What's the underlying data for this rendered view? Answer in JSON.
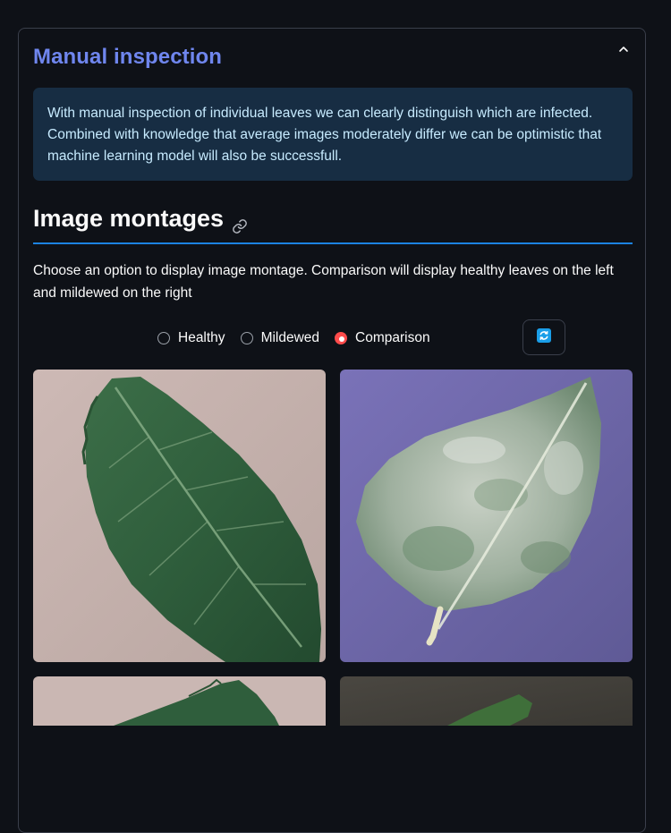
{
  "expander": {
    "title": "Manual inspection",
    "collapse_icon": "chevron-up-icon"
  },
  "info": {
    "text": "With manual inspection of individual leaves we can clearly distinguish which are infected. Combined with knowledge that average images moderately differ we can be optimistic that machine learning model will also be successfull."
  },
  "section": {
    "title": "Image montages",
    "anchor_icon": "link-icon"
  },
  "description": "Choose an option to display image montage. Comparison will display healthy leaves on the left and mildewed on the right",
  "radio": {
    "options": [
      "Healthy",
      "Mildewed",
      "Comparison"
    ],
    "selected": "Comparison"
  },
  "refresh_button": {
    "icon": "refresh-icon"
  },
  "images": [
    {
      "name": "healthy-leaf-image",
      "type": "healthy"
    },
    {
      "name": "mildewed-leaf-image",
      "type": "mildewed"
    },
    {
      "name": "healthy-leaf-image",
      "type": "healthy"
    },
    {
      "name": "mildewed-leaf-image",
      "type": "mildewed"
    }
  ],
  "colors": {
    "background": "#0e1117",
    "expander_title": "#6f86ee",
    "info_bg": "#172d43",
    "info_text": "#c7ebff",
    "divider": "#1c83e1",
    "radio_selected": "#ff4b4b"
  }
}
